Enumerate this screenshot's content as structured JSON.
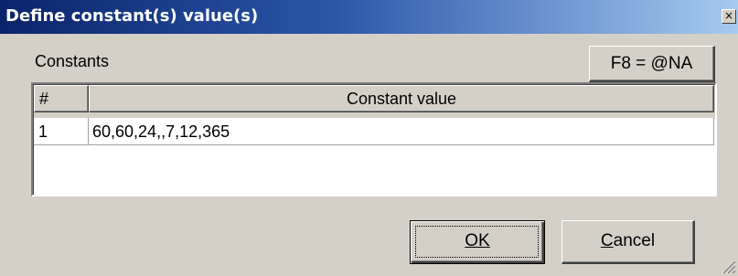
{
  "window": {
    "title": "Define constant(s) value(s)",
    "close_glyph": "×"
  },
  "section": {
    "label": "Constants",
    "f8_button_label": "F8 = @NA"
  },
  "grid": {
    "columns": [
      "#",
      "Constant value"
    ],
    "rows": [
      {
        "num": "1",
        "value": "60,60,24,,7,12,365"
      }
    ]
  },
  "buttons": {
    "ok_label": "OK",
    "cancel_label": "Cancel"
  },
  "colors": {
    "face": "#d4d0c8",
    "title_start": "#0a246a",
    "title_end": "#a6caf0"
  }
}
